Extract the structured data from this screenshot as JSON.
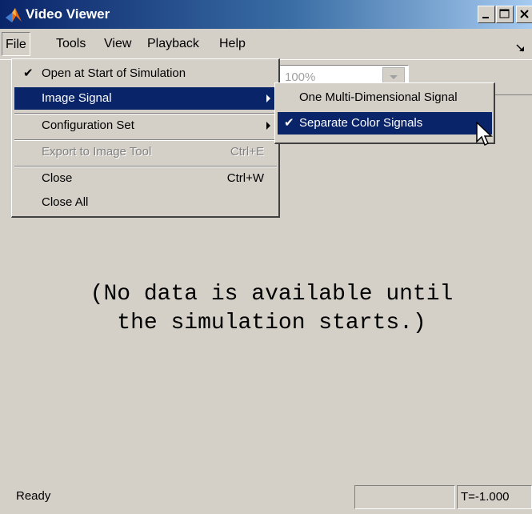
{
  "window": {
    "title": "Video Viewer"
  },
  "menubar": {
    "items": [
      "File",
      "Tools",
      "View",
      "Playback",
      "Help"
    ]
  },
  "toolbar": {
    "zoom_value": "100%"
  },
  "file_menu": {
    "items": [
      {
        "label": "Open at Start of Simulation",
        "checked": true
      },
      {
        "label": "Image Signal",
        "submenu": true,
        "highlighted": true
      },
      {
        "label": "Configuration Set",
        "submenu": true
      },
      {
        "label": "Export to Image Tool",
        "accelerator": "Ctrl+E",
        "disabled": true
      },
      {
        "label": "Close",
        "accelerator": "Ctrl+W"
      },
      {
        "label": "Close All"
      }
    ]
  },
  "image_signal_submenu": {
    "items": [
      {
        "label": "One Multi-Dimensional Signal",
        "checked": false
      },
      {
        "label": "Separate Color Signals",
        "checked": true,
        "highlighted": true
      }
    ]
  },
  "display": {
    "message_line1": "(No data is available until",
    "message_line2": "the simulation starts.)"
  },
  "statusbar": {
    "status": "Ready",
    "time": "T=-1.000"
  },
  "glyphs": {
    "check": "✔"
  },
  "colors": {
    "menu_highlight": "#0a246a",
    "face": "#d4d0c8",
    "disabled_text": "#808080"
  }
}
